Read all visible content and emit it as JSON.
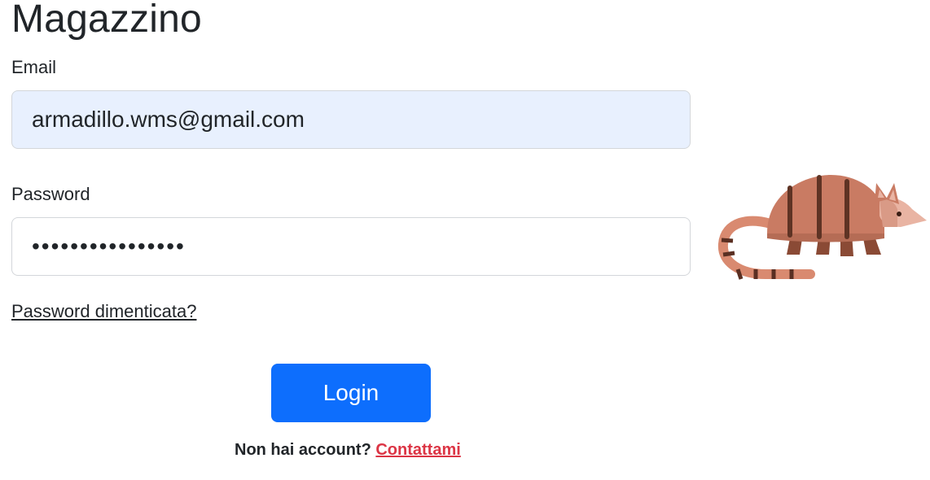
{
  "app": {
    "title": "Magazzino"
  },
  "form": {
    "email_label": "Email",
    "email_value": "armadillo.wms@gmail.com",
    "password_label": "Password",
    "password_value": "••••••••••••••••",
    "forgot_link": "Password dimenticata?",
    "login_button": "Login",
    "signup_prompt": "Non hai account?",
    "contact_link": "Contattami"
  },
  "illustration": {
    "icon": "armadillo-icon"
  },
  "colors": {
    "primary": "#0d6efd",
    "link_red": "#dc3545",
    "autofill_bg": "#e8f0fe",
    "armadillo_body": "#c97b63",
    "armadillo_stripes": "#6b3b2a"
  }
}
